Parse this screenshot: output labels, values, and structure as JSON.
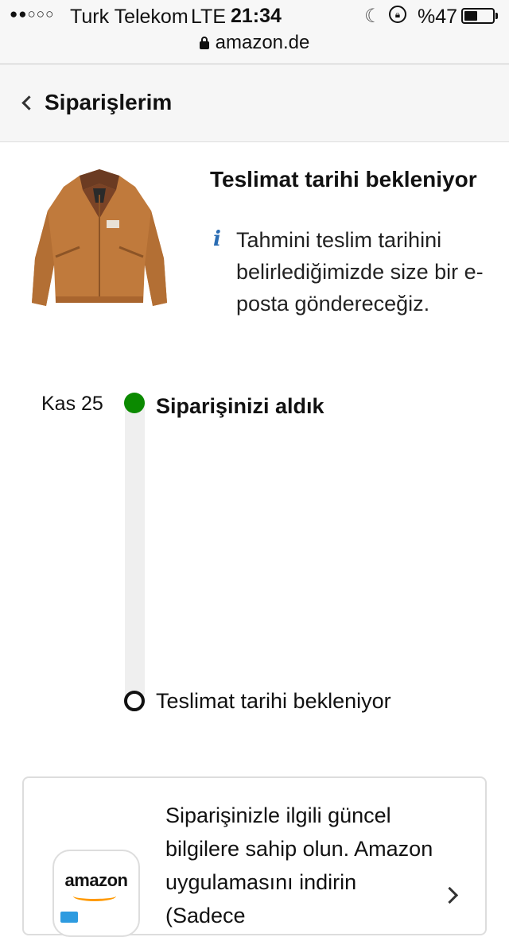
{
  "status_bar": {
    "signal": "●●○○○",
    "carrier": "Turk Telekom",
    "network": "LTE",
    "time": "21:34",
    "battery_percent": "%47",
    "battery_level": 0.47,
    "icons": [
      "moon-icon",
      "rotation-lock-icon",
      "battery-icon"
    ]
  },
  "browser": {
    "url": "amazon.de",
    "secure": true
  },
  "header": {
    "back_icon": "chevron-left-icon",
    "title": "Siparişlerim"
  },
  "product": {
    "image": "brown canvas work jacket",
    "delivery_status_title": "Teslimat tarihi bekleniyor",
    "info_icon": "i",
    "delivery_note": "Tahmini teslim tarihini belirlediğimizde size bir e-posta göndereceğiz."
  },
  "timeline": {
    "steps": [
      {
        "date": "Kas 25",
        "label": "Siparişinizi aldık",
        "done": true
      },
      {
        "date": "",
        "label": "Teslimat tarihi bekleniyor",
        "done": false
      }
    ]
  },
  "app_promo": {
    "app_icon_text": "amazon",
    "text": "Siparişinizle ilgili güncel bilgilere sahip olun. Amazon uygulamasını indirin (Sadece",
    "chevron_icon": "chevron-right-icon"
  },
  "colors": {
    "done_dot": "#0b8a00",
    "info_icon": "#2a6cb3",
    "smile": "#ff9900"
  }
}
